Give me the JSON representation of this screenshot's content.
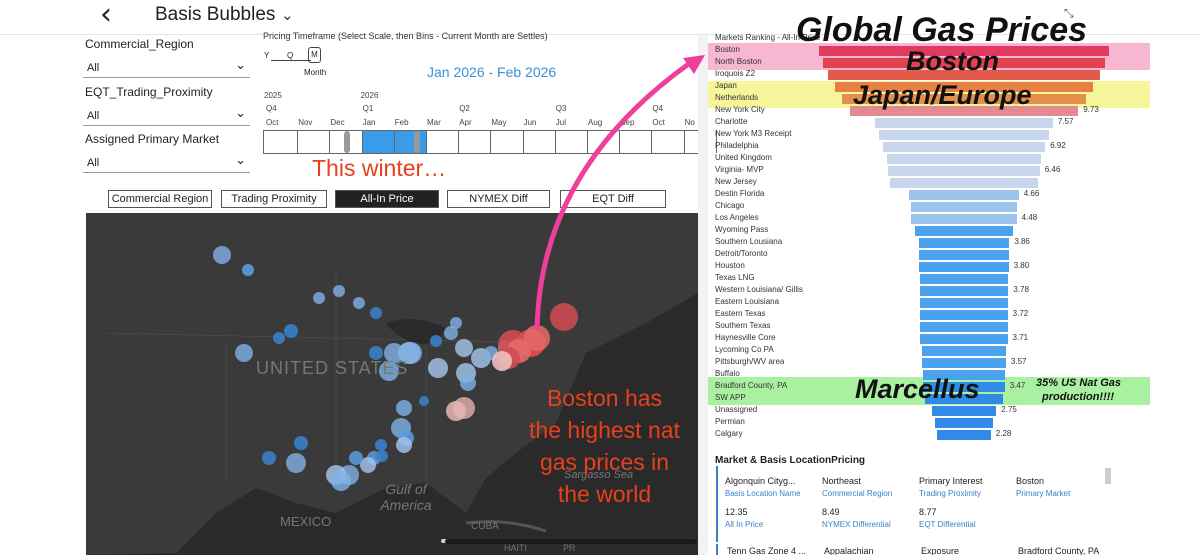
{
  "header": {
    "back_icon": "chevron-left-icon",
    "title": "Basis Bubbles"
  },
  "filters": [
    {
      "label": "Commercial_Region",
      "value": "All"
    },
    {
      "label": "EQT_Trading_Proximity",
      "value": "All"
    },
    {
      "label": "Assigned Primary Market",
      "value": "All"
    }
  ],
  "timeline": {
    "title": "Pricing Timeframe (Select Scale, then Bins - Current Month are Settles)",
    "scale_options": [
      "Y",
      "Q",
      "M"
    ],
    "scale_selected": "M",
    "scale_caption": "Month",
    "range_text": "Jan 2026 - Feb 2026",
    "years": [
      "2025",
      "2026"
    ],
    "quarters": [
      "Q4",
      "Q1",
      "Q2",
      "Q3",
      "Q4"
    ],
    "months": [
      "Oct",
      "Nov",
      "Dec",
      "Jan",
      "Feb",
      "Mar",
      "Apr",
      "May",
      "Jun",
      "Jul",
      "Aug",
      "Sep",
      "Oct",
      "No"
    ]
  },
  "toggles": [
    {
      "label": "Commercial Region",
      "selected": false
    },
    {
      "label": "Trading Proximity",
      "selected": false
    },
    {
      "label": "All-In Price",
      "selected": true
    },
    {
      "label": "NYMEX Diff",
      "selected": false
    },
    {
      "label": "EQT Diff",
      "selected": false
    }
  ],
  "map": {
    "labels": {
      "country": "UNITED STATES",
      "gulf": "Gulf of America",
      "mexico": "MEXICO",
      "sargasso": "Sargasso Sea",
      "cuba": "CUBA",
      "haiti": "HAITI",
      "pr": "PR"
    }
  },
  "ranking": {
    "title": "Markets Ranking - All-In Price",
    "markets": [
      {
        "name": "Boston",
        "value": 12.35,
        "label": ""
      },
      {
        "name": "North Boston",
        "value": 12.0,
        "label": ""
      },
      {
        "name": "Iroquois Z2",
        "value": 11.6,
        "label": ""
      },
      {
        "name": "Japan",
        "value": 11.0,
        "label": ""
      },
      {
        "name": "Netherlands",
        "value": 10.4,
        "label": ""
      },
      {
        "name": "New York City",
        "value": 9.73,
        "label": "9.73"
      },
      {
        "name": "Charlotte",
        "value": 7.57,
        "label": "7.57"
      },
      {
        "name": "New York M3 Receipt",
        "value": 7.2,
        "label": ""
      },
      {
        "name": "Philadelphia",
        "value": 6.92,
        "label": "6.92"
      },
      {
        "name": "United Kingdom",
        "value": 6.6,
        "label": ""
      },
      {
        "name": "Virginia- MVP",
        "value": 6.46,
        "label": "6.46"
      },
      {
        "name": "New Jersey",
        "value": 6.3,
        "label": ""
      },
      {
        "name": "Destin Florida",
        "value": 4.66,
        "label": "4.66"
      },
      {
        "name": "Chicago",
        "value": 4.55,
        "label": ""
      },
      {
        "name": "Los Angeles",
        "value": 4.48,
        "label": "4.48"
      },
      {
        "name": "Wyoming Pass",
        "value": 4.2,
        "label": ""
      },
      {
        "name": "Southern Lousiana",
        "value": 3.86,
        "label": "3.86"
      },
      {
        "name": "Detroit/Toronto",
        "value": 3.84,
        "label": ""
      },
      {
        "name": "Houston",
        "value": 3.8,
        "label": "3.80"
      },
      {
        "name": "Texas LNG",
        "value": 3.79,
        "label": ""
      },
      {
        "name": "Western Louisiana/ Gillis",
        "value": 3.78,
        "label": "3.78"
      },
      {
        "name": "Eastern Louisiana",
        "value": 3.75,
        "label": ""
      },
      {
        "name": "Eastern Texas",
        "value": 3.72,
        "label": "3.72"
      },
      {
        "name": "Southern Texas",
        "value": 3.71,
        "label": ""
      },
      {
        "name": "Haynesville Core",
        "value": 3.71,
        "label": "3.71"
      },
      {
        "name": "Lycoming Co PA",
        "value": 3.6,
        "label": ""
      },
      {
        "name": "Pittsburgh/WV area",
        "value": 3.57,
        "label": "3.57"
      },
      {
        "name": "Buffalo",
        "value": 3.5,
        "label": ""
      },
      {
        "name": "Bradford County, PA",
        "value": 3.47,
        "label": "3.47"
      },
      {
        "name": "SW APP",
        "value": 3.3,
        "label": ""
      },
      {
        "name": "Unassigned",
        "value": 2.75,
        "label": "2.75"
      },
      {
        "name": "Permian",
        "value": 2.5,
        "label": ""
      },
      {
        "name": "Calgary",
        "value": 2.28,
        "label": "2.28"
      }
    ]
  },
  "annotations": {
    "global": "Global Gas Prices",
    "boston": "Boston",
    "japan_europe": "Japan/Europe",
    "marcellus": "Marcellus",
    "marcellus_note_1": "35% US Nat Gas",
    "marcellus_note_2": "production!!!!",
    "this_winter": "This winter…",
    "boston_claim": [
      "Boston has",
      "the highest nat",
      "gas prices in",
      "the world"
    ]
  },
  "location_table": {
    "title": "Market & Basis LocationPricing",
    "row1": [
      {
        "value": "Algonquin Cityg...",
        "label": "Basis Location Name"
      },
      {
        "value": "Northeast",
        "label": "Commercial Region"
      },
      {
        "value": "Primary Interest",
        "label": "Trading Proximity"
      },
      {
        "value": "Boston",
        "label": "Primary Market"
      }
    ],
    "row2": [
      {
        "value": "12.35",
        "label": "All In Price"
      },
      {
        "value": "8.49",
        "label": "NYMEX Differential"
      },
      {
        "value": "8.77",
        "label": "EQT Differential"
      }
    ],
    "row3": [
      "Tenn Gas Zone 4 ...",
      "Appalachian",
      "Exposure",
      "Bradford County, PA"
    ]
  },
  "colors": {
    "pink_highlight": "#f7b6d2",
    "yellow_highlight": "#f7f59a",
    "green_highlight": "#a9f0a0",
    "annotation_red": "#e8401c",
    "arrow_pink": "#ee3f9a"
  }
}
